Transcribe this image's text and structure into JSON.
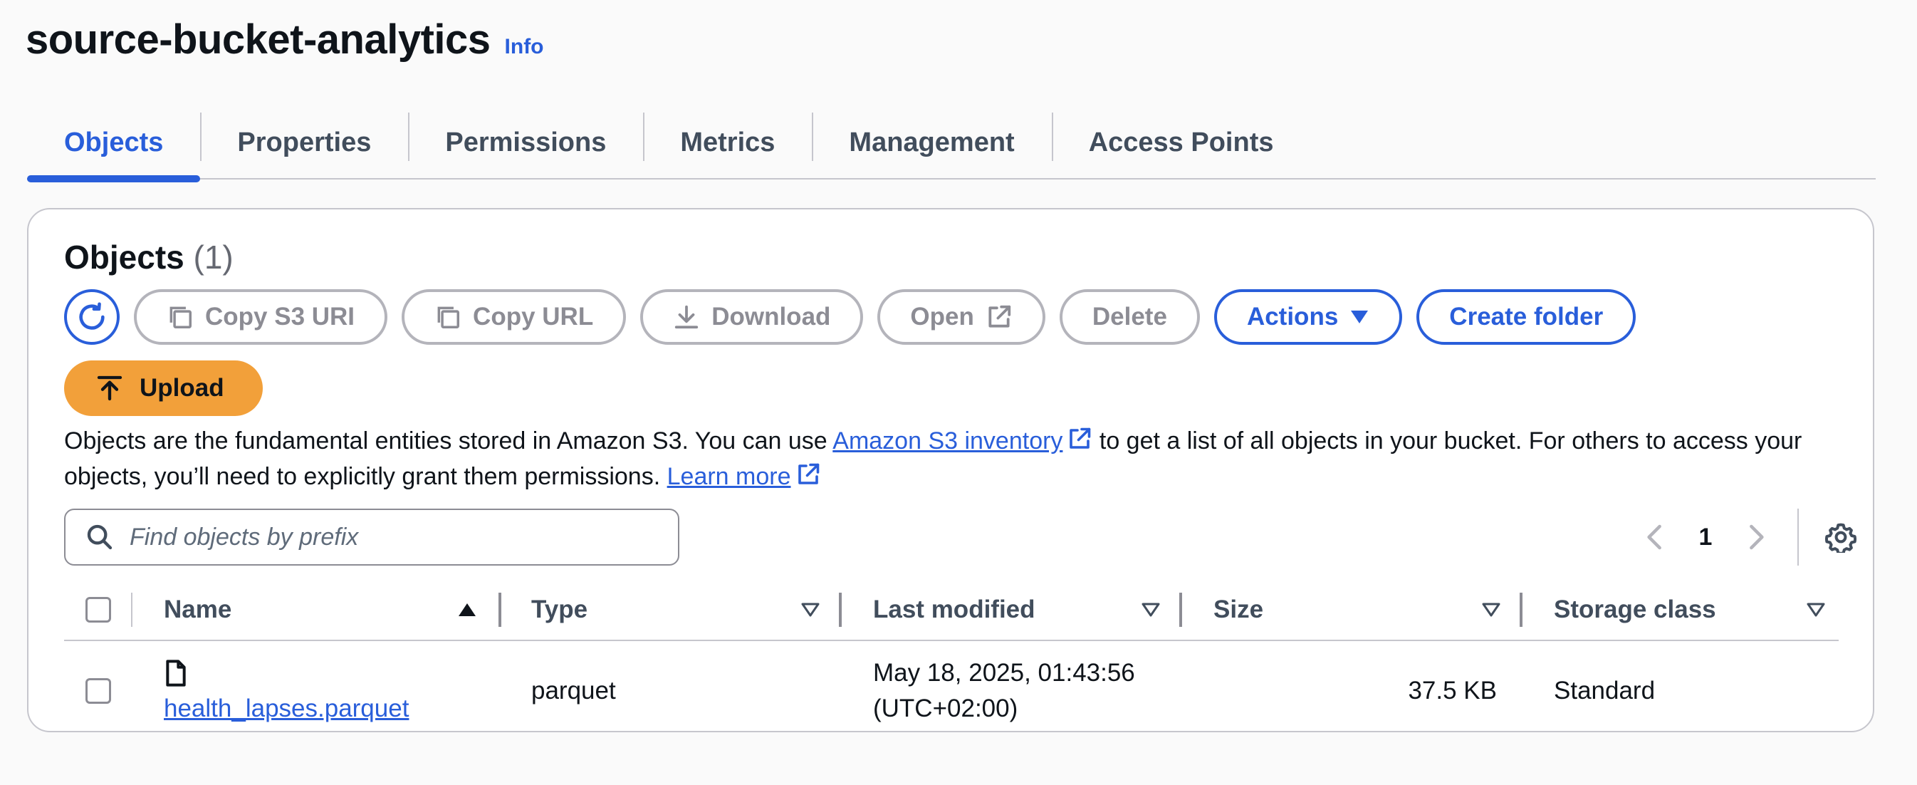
{
  "header": {
    "title": "source-bucket-analytics",
    "info_label": "Info"
  },
  "tabs": [
    {
      "label": "Objects",
      "active": true
    },
    {
      "label": "Properties"
    },
    {
      "label": "Permissions"
    },
    {
      "label": "Metrics"
    },
    {
      "label": "Management"
    },
    {
      "label": "Access Points"
    }
  ],
  "objects_panel": {
    "title": "Objects",
    "count": "(1)",
    "toolbar": {
      "copy_s3_uri": "Copy S3 URI",
      "copy_url": "Copy URL",
      "download": "Download",
      "open": "Open",
      "delete": "Delete",
      "actions": "Actions",
      "create_folder": "Create folder",
      "upload": "Upload"
    },
    "description": {
      "part1": "Objects are the fundamental entities stored in Amazon S3. You can use ",
      "inventory_link": "Amazon S3 inventory",
      "part2": " to get a list of all objects in your bucket. For others to access your objects, you’ll need to explicitly grant them permissions. ",
      "learn_more_link": "Learn more"
    },
    "search": {
      "placeholder": "Find objects by prefix",
      "value": ""
    },
    "pagination": {
      "current_page": "1"
    },
    "table": {
      "columns": [
        "Name",
        "Type",
        "Last modified",
        "Size",
        "Storage class"
      ],
      "rows": [
        {
          "name": "health_lapses.parquet",
          "type": "parquet",
          "last_modified_line1": "May 18, 2025, 01:43:56",
          "last_modified_line2": "(UTC+02:00)",
          "size": "37.5 KB",
          "storage_class": "Standard"
        }
      ]
    }
  },
  "colors": {
    "accent": "#295eda",
    "upload_button": "#f2a03a",
    "disabled_text": "#8c8c94"
  }
}
